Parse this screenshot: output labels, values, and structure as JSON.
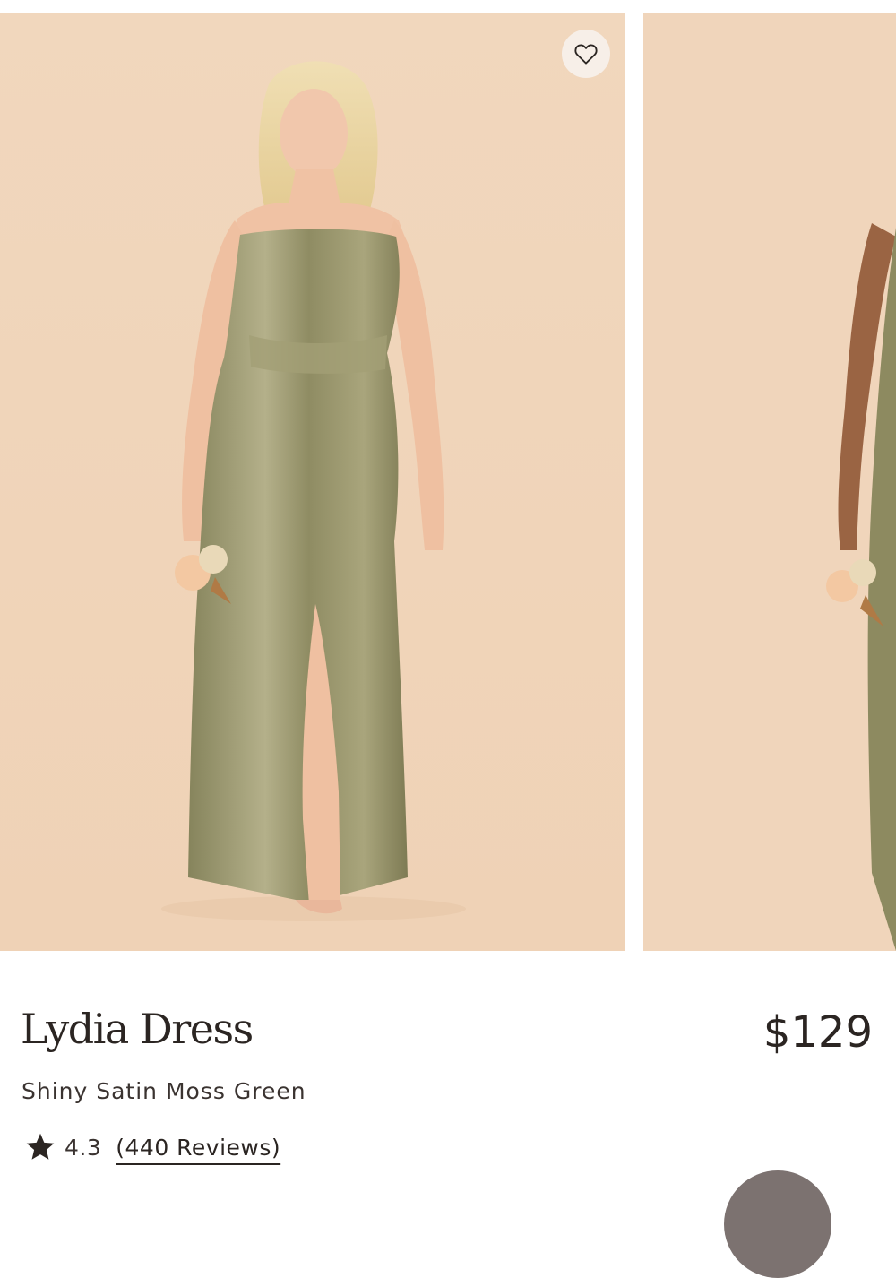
{
  "colors": {
    "image_background": "#f0d5bb",
    "dress": "#8e8c64",
    "text": "#2b2522",
    "fab": "#7c7270"
  },
  "carousel": {
    "favorite_icon": "heart-outline-icon",
    "slides": [
      {
        "name": "model-front-view"
      },
      {
        "name": "model-second-view"
      }
    ]
  },
  "product": {
    "title": "Lydia Dress",
    "price": "$129",
    "subtitle": "Shiny Satin Moss Green",
    "rating": "4.3",
    "reviews_label": "(440 Reviews)",
    "rating_icon": "star-icon"
  }
}
